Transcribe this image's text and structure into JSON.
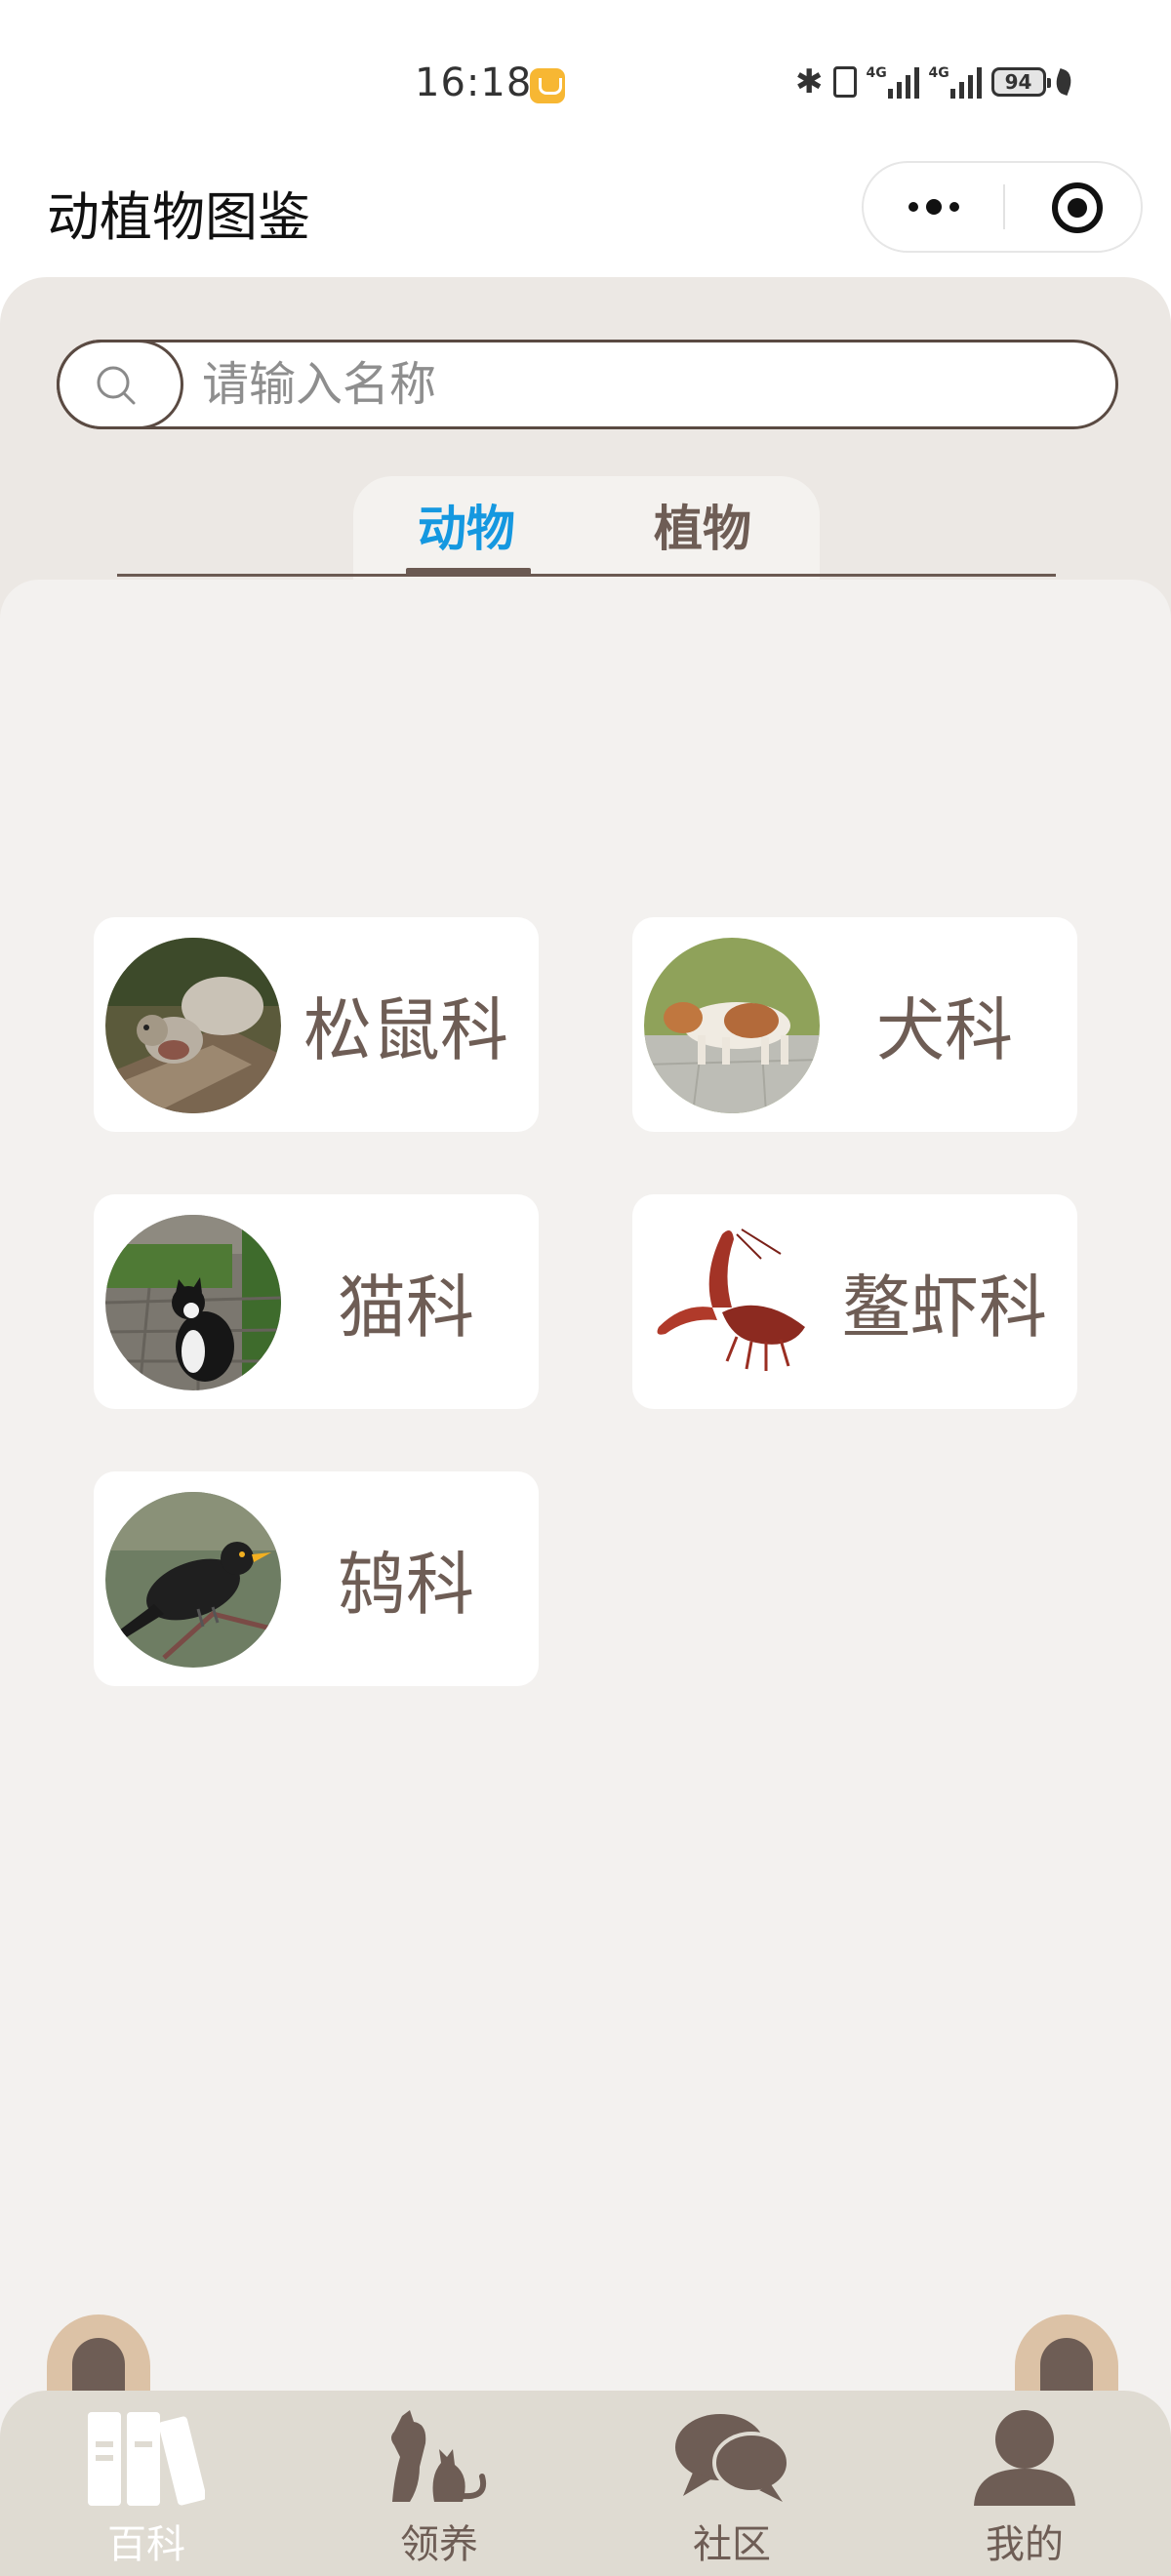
{
  "status_bar": {
    "time": "16:18",
    "battery": "94",
    "network": [
      "4G",
      "4G"
    ]
  },
  "title_bar": {
    "title": "动植物图鉴"
  },
  "search": {
    "placeholder": "请输入名称"
  },
  "tabs": [
    {
      "label": "动物",
      "active": true
    },
    {
      "label": "植物",
      "active": false
    }
  ],
  "categories": [
    {
      "label": "松鼠科",
      "image": "squirrel"
    },
    {
      "label": "犬科",
      "image": "dog"
    },
    {
      "label": "猫科",
      "image": "cat"
    },
    {
      "label": "鳌虾科",
      "image": "crayfish"
    },
    {
      "label": "鸫科",
      "image": "thrush"
    }
  ],
  "tab_bar": [
    {
      "label": "百科",
      "icon": "books-icon",
      "active": true
    },
    {
      "label": "领养",
      "icon": "dog-cat-icon",
      "active": false
    },
    {
      "label": "社区",
      "icon": "chat-bubbles-icon",
      "active": false
    },
    {
      "label": "我的",
      "icon": "person-icon",
      "active": false
    }
  ],
  "colors": {
    "accent": "#1598e0",
    "brown": "#6e5d55",
    "panel": "#ece8e4",
    "tabbar": "#dfdbd2"
  }
}
